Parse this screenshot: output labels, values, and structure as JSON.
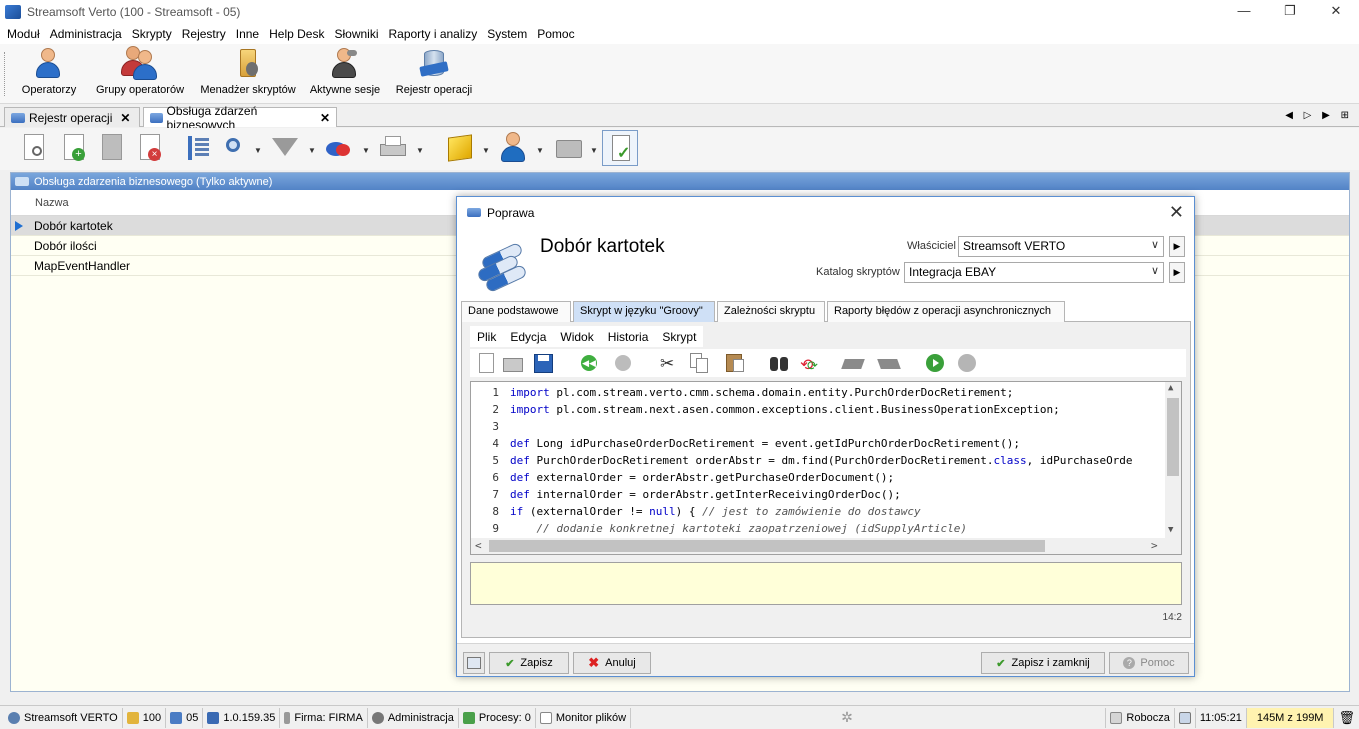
{
  "window": {
    "title": "Streamsoft Verto (100 - Streamsoft - 05)",
    "min": "—",
    "max": "❐",
    "close": "✕"
  },
  "menu": [
    "Moduł",
    "Administracja",
    "Skrypty",
    "Rejestry",
    "Inne",
    "Help Desk",
    "Słowniki",
    "Raporty i analizy",
    "System",
    "Pomoc"
  ],
  "ribbon": [
    "Operatorzy",
    "Grupy operatorów",
    "Menadżer skryptów",
    "Aktywne sesje",
    "Rejestr operacji"
  ],
  "doc_tabs": [
    {
      "label": "Rejestr operacji",
      "close": "✕"
    },
    {
      "label": "Obsługa zdarzeń biznesowych",
      "close": "✕"
    }
  ],
  "tab_nav": "◀ ▷ ▶ ⊞",
  "grid": {
    "header": "Obsługa zdarzenia biznesowego (Tylko aktywne)",
    "column": "Nazwa",
    "rows": [
      "Dobór kartotek",
      "Dobór ilości",
      "MapEventHandler"
    ]
  },
  "dialog": {
    "title": "Poprawa",
    "heading": "Dobór kartotek",
    "owner_label": "Właściciel",
    "owner_value": "Streamsoft VERTO",
    "catalog_label": "Katalog skryptów",
    "catalog_value": "Integracja EBAY",
    "tabs": [
      "Dane podstawowe",
      "Skrypt w języku \"Groovy\"",
      "Zależności skryptu",
      "Raporty błędów z operacji asynchronicznych"
    ],
    "editor_menu": [
      "Plik",
      "Edycja",
      "Widok",
      "Historia",
      "Skrypt"
    ],
    "code_lines": [
      {
        "n": "1",
        "kw": "import",
        "rest": " pl.com.stream.verto.cmm.schema.domain.entity.PurchOrderDocRetirement;"
      },
      {
        "n": "2",
        "kw": "import",
        "rest": " pl.com.stream.next.asen.common.exceptions.client.BusinessOperationException;"
      },
      {
        "n": "3",
        "kw": "",
        "rest": ""
      },
      {
        "n": "4",
        "kw": "def",
        "rest": " Long idPurchaseOrderDocRetirement = event.getIdPurchOrderDocRetirement();"
      },
      {
        "n": "5",
        "kw": "def",
        "rest": " PurchOrderDocRetirement orderAbstr = dm.find(PurchOrderDocRetirement.",
        "kw2": "class",
        "rest2": ", idPurchaseOrde"
      },
      {
        "n": "6",
        "kw": "def",
        "rest": " externalOrder = orderAbstr.getPurchaseOrderDocument();"
      },
      {
        "n": "7",
        "kw": "def",
        "rest": " internalOrder = orderAbstr.getInterReceivingOrderDoc();"
      },
      {
        "n": "8",
        "kw": "if",
        "rest": " (externalOrder != ",
        "kw2": "null",
        "rest2": ") { ",
        "cmt": "// jest to zamówienie do dostawcy"
      },
      {
        "n": "9",
        "kw": "",
        "rest": "    ",
        "cmt": "// dodanie konkretnej kartoteki zaopatrzeniowej (idSupplyArticle)"
      }
    ],
    "cursor_pos": "14:2",
    "buttons": {
      "save": "Zapisz",
      "cancel": "Anuluj",
      "save_close": "Zapisz i zamknij",
      "help": "Pomoc"
    }
  },
  "status": {
    "user": "Streamsoft VERTO",
    "company_no": "100",
    "branch": "05",
    "version": "1.0.159.35",
    "firma": "Firma: FIRMA",
    "module": "Administracja",
    "processes": "Procesy: 0",
    "monitor": "Monitor plików",
    "mode": "Robocza",
    "time": "11:05:21",
    "memory": "145M z 199M"
  }
}
